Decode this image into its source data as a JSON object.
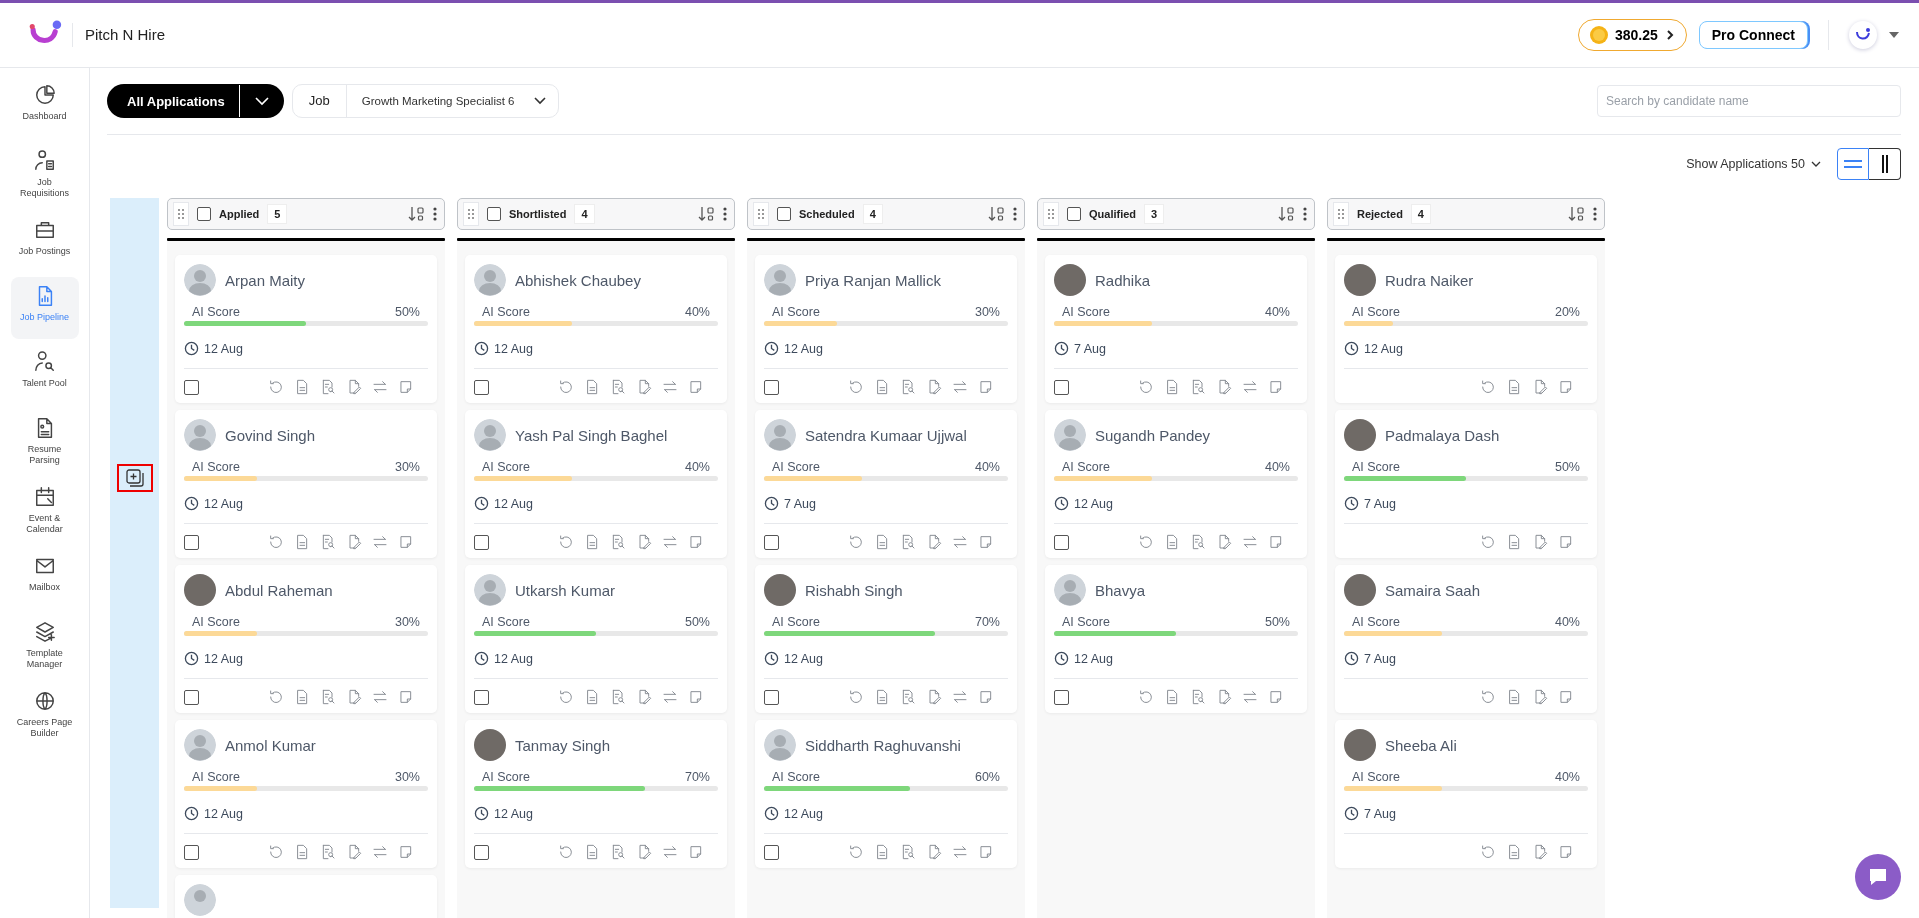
{
  "header": {
    "brand": "Pitch N Hire",
    "credits": "380.25",
    "pro_button": "Pro Connect"
  },
  "sidebar": {
    "items": [
      {
        "label": "Dashboard",
        "selected": false
      },
      {
        "label": "Job Requisitions",
        "selected": false
      },
      {
        "label": "Job Postings",
        "selected": false
      },
      {
        "label": "Job Pipeline",
        "selected": true
      },
      {
        "label": "Talent Pool",
        "selected": false
      },
      {
        "label": "Resume Parsing",
        "selected": false
      },
      {
        "label": "Event & Calendar",
        "selected": false
      },
      {
        "label": "Mailbox",
        "selected": false
      },
      {
        "label": "Template Manager",
        "selected": false
      },
      {
        "label": "Careers Page Builder",
        "selected": false
      }
    ]
  },
  "toolbar": {
    "view_button": "All Applications",
    "job_label": "Job",
    "job_value": "Growth Marketing Specialist 6",
    "search": {
      "placeholder": "Search by candidate name"
    }
  },
  "show_applications": "Show Applications 50",
  "view_modes": [
    {
      "selected": true
    },
    {
      "selected": false
    }
  ],
  "columns": [
    {
      "kind": "open",
      "title": "Applied",
      "count": "5",
      "checked": false,
      "more_below": true,
      "cards": [
        {
          "name": "Arpan Maity",
          "photo": false,
          "score_label": "AI Score",
          "score": "50%",
          "level": 0.5,
          "date": "12 Aug",
          "checked": false
        },
        {
          "name": "Govind Singh",
          "photo": false,
          "score_label": "AI Score",
          "score": "30%",
          "level": 0.3,
          "date": "12 Aug",
          "checked": false
        },
        {
          "name": "Abdul Raheman",
          "photo": true,
          "score_label": "AI Score",
          "score": "30%",
          "level": 0.3,
          "date": "12 Aug",
          "checked": false
        },
        {
          "name": "Anmol Kumar",
          "photo": false,
          "score_label": "AI Score",
          "score": "30%",
          "level": 0.3,
          "date": "12 Aug",
          "checked": false
        }
      ]
    },
    {
      "kind": "open",
      "title": "Shortlisted",
      "count": "4",
      "checked": false,
      "cards": [
        {
          "name": "Abhishek Chaubey",
          "photo": false,
          "score_label": "AI Score",
          "score": "40%",
          "level": 0.4,
          "date": "12 Aug",
          "checked": false
        },
        {
          "name": "Yash Pal Singh Baghel",
          "photo": false,
          "score_label": "AI Score",
          "score": "40%",
          "level": 0.4,
          "date": "12 Aug",
          "checked": false
        },
        {
          "name": "Utkarsh Kumar",
          "photo": false,
          "score_label": "AI Score",
          "score": "50%",
          "level": 0.5,
          "date": "12 Aug",
          "checked": false
        },
        {
          "name": "Tanmay Singh",
          "photo": true,
          "score_label": "AI Score",
          "score": "70%",
          "level": 0.7,
          "date": "12 Aug",
          "checked": false
        }
      ]
    },
    {
      "kind": "open",
      "title": "Scheduled",
      "count": "4",
      "checked": false,
      "cards": [
        {
          "name": "Priya Ranjan Mallick",
          "photo": false,
          "score_label": "AI Score",
          "score": "30%",
          "level": 0.3,
          "date": "12 Aug",
          "checked": false
        },
        {
          "name": "Satendra Kumaar Ujjwal",
          "photo": false,
          "score_label": "AI Score",
          "score": "40%",
          "level": 0.4,
          "date": "7 Aug",
          "checked": false
        },
        {
          "name": "Rishabh Singh",
          "photo": true,
          "score_label": "AI Score",
          "score": "70%",
          "level": 0.7,
          "date": "12 Aug",
          "checked": false
        },
        {
          "name": "Siddharth Raghuvanshi",
          "photo": false,
          "score_label": "AI Score",
          "score": "60%",
          "level": 0.6,
          "date": "12 Aug",
          "checked": false
        }
      ]
    },
    {
      "kind": "open",
      "title": "Qualified",
      "count": "3",
      "checked": false,
      "cards": [
        {
          "name": "Radhika",
          "photo": true,
          "score_label": "AI Score",
          "score": "40%",
          "level": 0.4,
          "date": "7 Aug",
          "checked": false
        },
        {
          "name": "Sugandh Pandey",
          "photo": false,
          "score_label": "AI Score",
          "score": "40%",
          "level": 0.4,
          "date": "12 Aug",
          "checked": false
        },
        {
          "name": "Bhavya",
          "photo": false,
          "score_label": "AI Score",
          "score": "50%",
          "level": 0.5,
          "date": "12 Aug",
          "checked": false
        }
      ]
    },
    {
      "kind": "rejected",
      "title": "Rejected",
      "count": "4",
      "cards": [
        {
          "name": "Rudra Naiker",
          "photo": true,
          "score_label": "AI Score",
          "score": "20%",
          "level": 0.2,
          "date": "12 Aug"
        },
        {
          "name": "Padmalaya Dash",
          "photo": true,
          "score_label": "AI Score",
          "score": "50%",
          "level": 0.5,
          "date": "7 Aug"
        },
        {
          "name": "Samaira Saah",
          "photo": true,
          "score_label": "AI Score",
          "score": "40%",
          "level": 0.4,
          "date": "7 Aug"
        },
        {
          "name": "Sheeba Ali",
          "photo": true,
          "score_label": "AI Score",
          "score": "40%",
          "level": 0.4,
          "date": "7 Aug"
        }
      ]
    }
  ]
}
